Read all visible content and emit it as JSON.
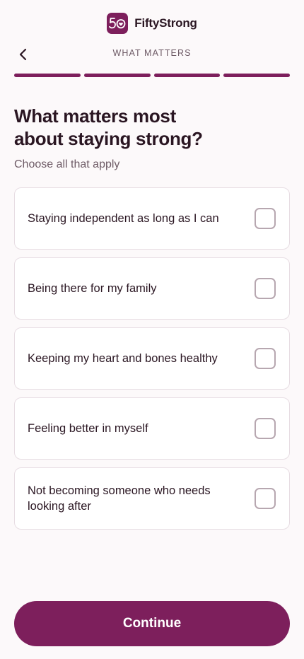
{
  "brand": {
    "name": "FiftyStrong",
    "logo_icon": "fifty-heart-logo-icon",
    "accent_color": "#7d1f5c"
  },
  "header": {
    "back_icon": "chevron-left-icon",
    "step_label": "WHAT MATTERS",
    "progress": {
      "segments_total": 4,
      "segments_complete": 4
    }
  },
  "question": {
    "title_line1": "What matters most",
    "title_line2": "about staying strong?",
    "subtitle": "Choose all that apply"
  },
  "options": [
    {
      "label": "Staying independent as long as I can",
      "checked": false
    },
    {
      "label": "Being there for my family",
      "checked": false
    },
    {
      "label": "Keeping my heart and bones healthy",
      "checked": false
    },
    {
      "label": "Feeling better in myself",
      "checked": false
    },
    {
      "label": "Not becoming someone who needs looking after",
      "checked": false
    }
  ],
  "footer": {
    "continue_label": "Continue"
  }
}
